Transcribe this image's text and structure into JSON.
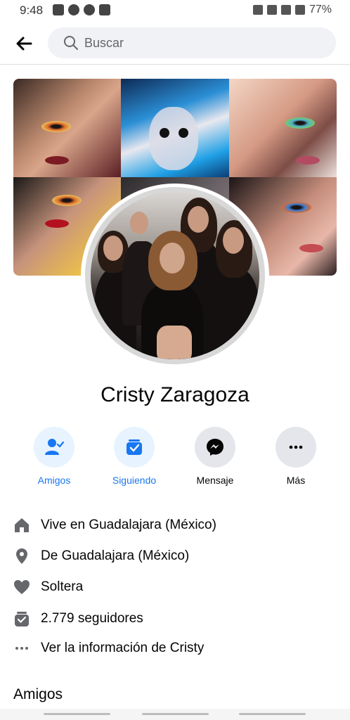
{
  "status_bar": {
    "time": "9:48",
    "battery": "77%"
  },
  "header": {
    "search_placeholder": "Buscar"
  },
  "profile": {
    "name": "Cristy Zaragoza"
  },
  "actions": [
    {
      "label": "Amigos",
      "icon": "friends-check-icon"
    },
    {
      "label": "Siguiendo",
      "icon": "following-inbox-icon"
    },
    {
      "label": "Mensaje",
      "icon": "messenger-icon"
    },
    {
      "label": "Más",
      "icon": "more-dots-icon"
    }
  ],
  "info": {
    "lives_prefix": "Vive en ",
    "lives_place": "Guadalajara (México)",
    "from_prefix": "De ",
    "from_place": "Guadalajara (México)",
    "relationship": "Soltera",
    "followers": "2.779 seguidores",
    "see_info": "Ver la información de Cristy"
  },
  "sections": {
    "friends_title": "Amigos"
  },
  "colors": {
    "accent": "#1877f2",
    "accent_bg": "#e7f3ff",
    "icon_grey": "#65676b"
  }
}
